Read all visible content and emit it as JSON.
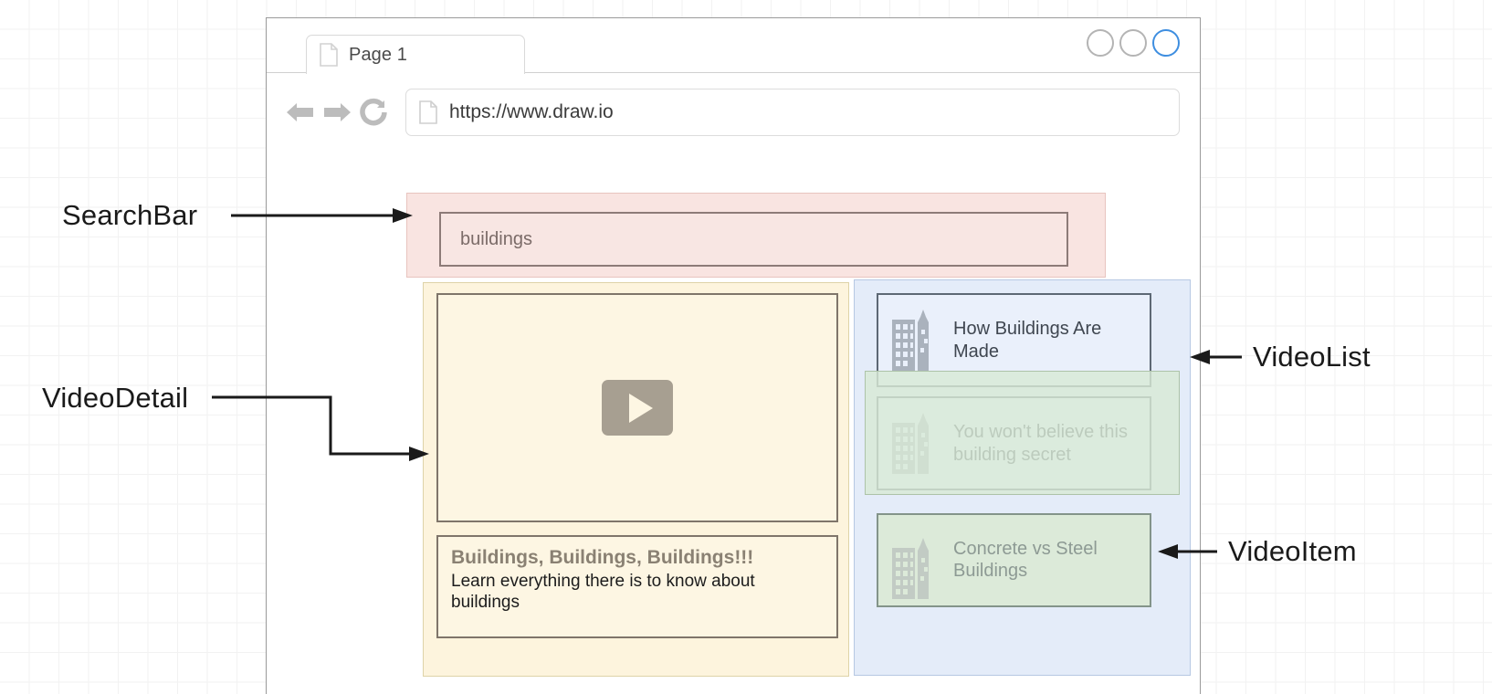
{
  "browser": {
    "tab": {
      "label": "Page 1",
      "icon": "page-document-icon"
    },
    "window_controls": [
      {
        "name": "window-dot-1",
        "color": "#b4b4b4"
      },
      {
        "name": "window-dot-2",
        "color": "#b4b4b4"
      },
      {
        "name": "window-dot-3",
        "color": "#3e8ee0"
      }
    ],
    "toolbar": {
      "back_icon": "back-arrow-icon",
      "forward_icon": "forward-arrow-icon",
      "reload_icon": "reload-icon",
      "url_icon": "page-document-icon",
      "url": "https://www.draw.io"
    }
  },
  "page": {
    "search_bar": {
      "value": "buildings",
      "placeholder": "buildings"
    },
    "video_detail": {
      "player_icon": "play-button-icon",
      "title": "Buildings, Buildings, Buildings!!!",
      "description": "Learn everything there is to know about buildings"
    },
    "video_list": {
      "items": [
        {
          "icon": "buildings-icon",
          "title": "How Buildings Are Made"
        },
        {
          "icon": "buildings-icon",
          "title": "You won't believe this building secret"
        },
        {
          "icon": "buildings-icon",
          "title": "Concrete vs Steel Buildings"
        }
      ]
    }
  },
  "annotations": [
    {
      "id": "searchbar",
      "label": "SearchBar"
    },
    {
      "id": "videodetail",
      "label": "VideoDetail"
    },
    {
      "id": "videolist",
      "label": "VideoList"
    },
    {
      "id": "videoitem",
      "label": "VideoItem"
    }
  ],
  "colors": {
    "searchbar_zone": "#f9e4e1",
    "videodetail_zone": "#fdf4dd",
    "videolist_zone": "#e4ecf9",
    "videoitem_zone": "#d8e9d5",
    "accent_blue": "#3e8ee0"
  }
}
